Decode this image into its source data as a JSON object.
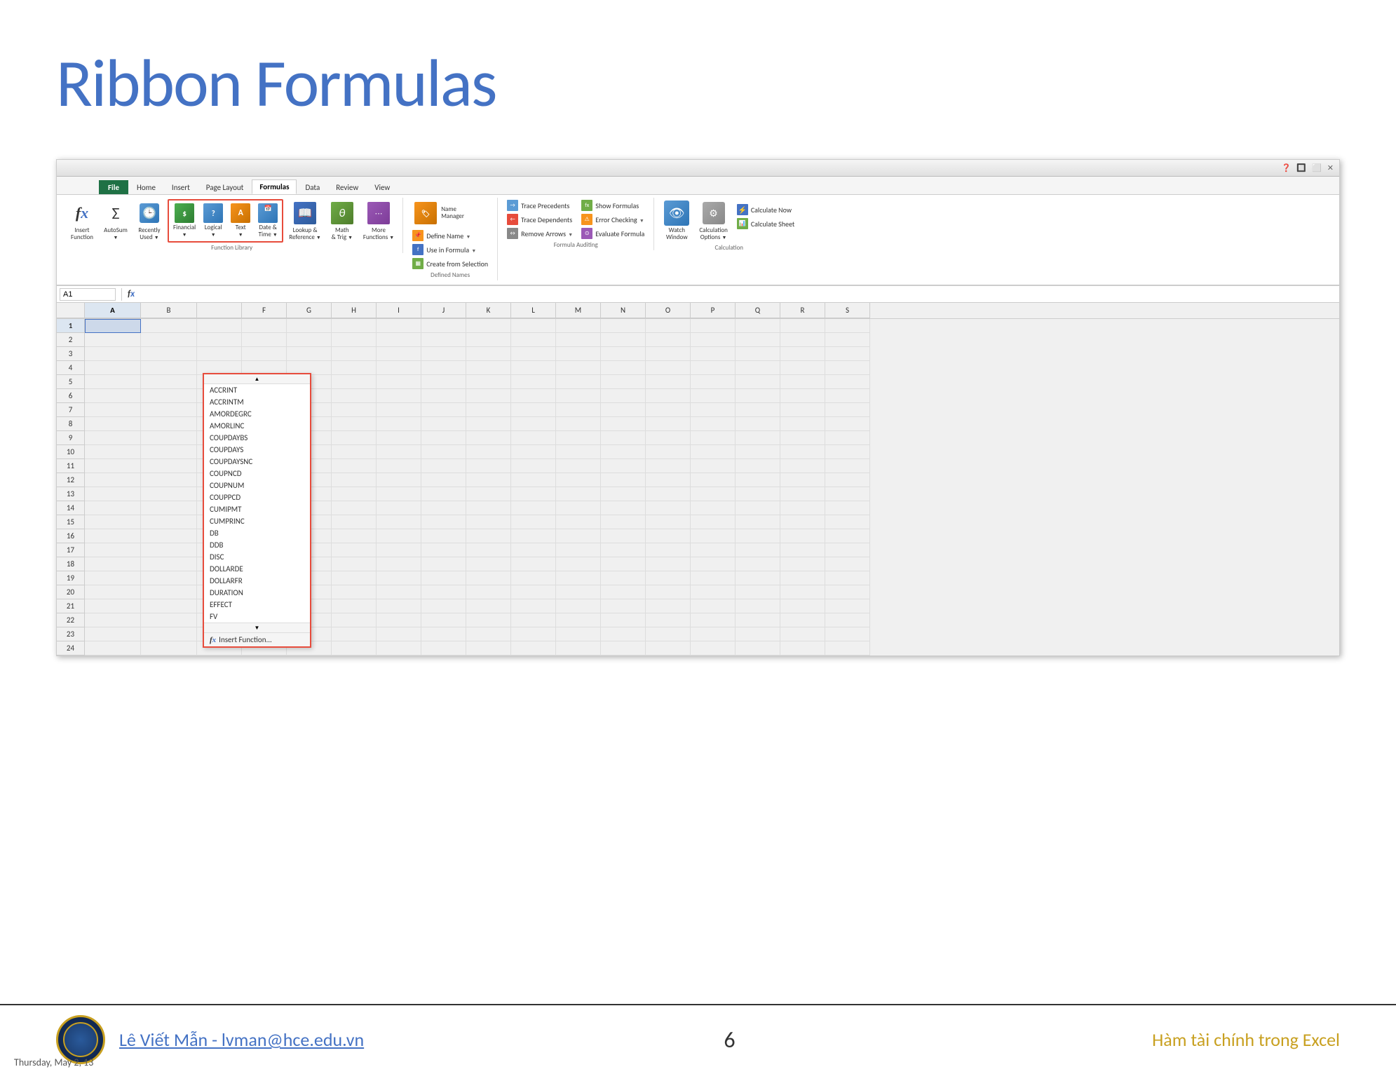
{
  "page": {
    "title": "Ribbon Formulas",
    "background": "#ffffff"
  },
  "ribbon": {
    "tabs": [
      "File",
      "Home",
      "Insert",
      "Page Layout",
      "Formulas",
      "Data",
      "Review",
      "View"
    ],
    "active_tab": "Formulas",
    "groups": {
      "function_library": {
        "label": "Function Library",
        "buttons": [
          {
            "id": "insert-function",
            "label": "Insert\nFunction",
            "icon": "fx"
          },
          {
            "id": "autosum",
            "label": "AutoSum",
            "icon": "Σ"
          },
          {
            "id": "recently-used",
            "label": "Recently\nUsed ▼",
            "icon": "clock"
          },
          {
            "id": "financial",
            "label": "Financial\n▼",
            "icon": "$"
          },
          {
            "id": "logical",
            "label": "Logical\n▼",
            "icon": "?"
          },
          {
            "id": "text",
            "label": "Text\n▼",
            "icon": "A"
          },
          {
            "id": "date-time",
            "label": "Date &\nTime ▼",
            "icon": "cal"
          },
          {
            "id": "lookup-ref",
            "label": "Lookup &\nReference ▼",
            "icon": "book"
          },
          {
            "id": "math-trig",
            "label": "Math\n& Trig ▼",
            "icon": "θ"
          },
          {
            "id": "more-functions",
            "label": "More\nFunctions ▼",
            "icon": "more"
          }
        ]
      },
      "defined_names": {
        "label": "Defined Names",
        "buttons": [
          {
            "id": "name-manager",
            "label": "Name\nManager",
            "icon": "tag"
          },
          {
            "id": "define-name",
            "label": "Define Name ▼"
          },
          {
            "id": "use-in-formula",
            "label": "Use in Formula ▼"
          },
          {
            "id": "create-from-selection",
            "label": "Create from Selection"
          }
        ]
      },
      "formula_auditing": {
        "label": "Formula Auditing",
        "buttons": [
          {
            "id": "trace-precedents",
            "label": "Trace Precedents"
          },
          {
            "id": "trace-dependents",
            "label": "Trace Dependents"
          },
          {
            "id": "remove-arrows",
            "label": "Remove Arrows ▼"
          },
          {
            "id": "show-formulas",
            "label": "Show Formulas"
          },
          {
            "id": "error-checking",
            "label": "Error Checking ▼"
          },
          {
            "id": "evaluate-formula",
            "label": "Evaluate Formula"
          }
        ]
      },
      "calculation": {
        "label": "Calculation",
        "buttons": [
          {
            "id": "watch-window",
            "label": "Watch\nWindow"
          },
          {
            "id": "calculation-options",
            "label": "Calculation\nOptions ▼"
          },
          {
            "id": "calculate-now",
            "label": "Calculate Now"
          },
          {
            "id": "calculate-sheet",
            "label": "Calculate Sheet"
          }
        ]
      }
    }
  },
  "formula_bar": {
    "cell_ref": "A1",
    "content": ""
  },
  "financial_dropdown": {
    "items": [
      "ACCRINT",
      "ACCRINTM",
      "AMORDEGRC",
      "AMORLINC",
      "COUPDAYBS",
      "COUPDAYS",
      "COUPDAYSNC",
      "COUPNCD",
      "COUPNUM",
      "COUPPCD",
      "CUMIPMT",
      "CUMPRINC",
      "DB",
      "DDB",
      "DISC",
      "DOLLARDE",
      "DOLLARFR",
      "DURATION",
      "EFFECT",
      "FV"
    ],
    "insert_function": "Insert Function..."
  },
  "spreadsheet": {
    "selected_cell": "A1",
    "columns": [
      "A",
      "B",
      "F",
      "G",
      "H",
      "I",
      "J",
      "K",
      "L",
      "M",
      "N",
      "O",
      "P",
      "Q",
      "R",
      "S"
    ],
    "rows": [
      1,
      2,
      3,
      4,
      5,
      6,
      7,
      8,
      9,
      10,
      11,
      12,
      13,
      14,
      15,
      16,
      17,
      18,
      19,
      20,
      21,
      22,
      23,
      24
    ]
  },
  "footer": {
    "author": "Lê Viết Mẫn - lvman@hce.edu.vn",
    "page_number": "6",
    "subject": "Hàm tài chính trong Excel",
    "date": "Thursday, May 2, 13"
  }
}
